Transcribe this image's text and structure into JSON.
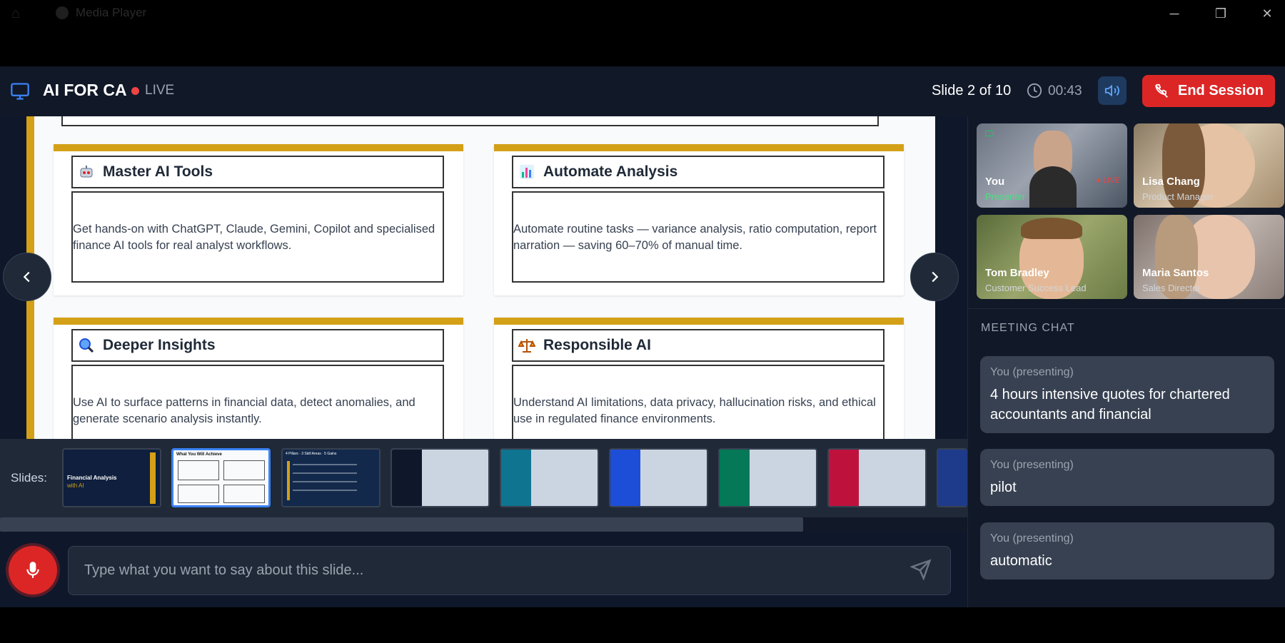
{
  "window": {
    "app_name": "Media Player",
    "home_icon": "home-icon",
    "minimize": "─",
    "maximize": "❐",
    "close": "✕"
  },
  "header": {
    "title": "AI FOR CA",
    "live_label": "LIVE",
    "slide_counter": "Slide 2 of 10",
    "timer": "00:43",
    "end_button": "End Session",
    "accent_color": "#dc2626"
  },
  "slide": {
    "accent_color": "#d4a017",
    "cards": [
      {
        "icon": "robot-icon",
        "title": "Master AI Tools",
        "body": "Get hands-on with ChatGPT, Claude, Gemini, Copilot and specialised finance AI tools for real analyst workflows."
      },
      {
        "icon": "bar-chart-icon",
        "title": "Automate Analysis",
        "body": "Automate routine tasks — variance analysis, ratio computation, report narration — saving 60–70% of manual time."
      },
      {
        "icon": "magnifier-icon",
        "title": "Deeper Insights",
        "body": "Use AI to surface patterns in financial data, detect anomalies, and generate scenario analysis instantly."
      },
      {
        "icon": "scales-icon",
        "title": "Responsible AI",
        "body": "Understand AI limitations, data privacy, hallucination risks, and ethical use in regulated finance environments."
      }
    ]
  },
  "strip": {
    "label": "Slides:",
    "thumb1_title": "Financial Analysis",
    "thumb1_sub": "with AI",
    "thumb2_title": "What You Will Achieve",
    "thumb3_title": "4 Pillars · 3 Skill Areas · 5 Gains"
  },
  "input": {
    "placeholder": "Type what you want to say about this slide..."
  },
  "participants": [
    {
      "name": "You",
      "role": "Presenter",
      "badge": "● LIVE"
    },
    {
      "name": "Lisa Chang",
      "role": "Product Manager"
    },
    {
      "name": "Tom Bradley",
      "role": "Customer Success Lead"
    },
    {
      "name": "Maria Santos",
      "role": "Sales Director"
    }
  ],
  "chat": {
    "label": "MEETING CHAT",
    "messages": [
      {
        "who": "You (presenting)",
        "text": "4 hours intensive quotes for chartered accountants and financial"
      },
      {
        "who": "You (presenting)",
        "text": "pilot"
      },
      {
        "who": "You (presenting)",
        "text": "automatic"
      }
    ]
  }
}
